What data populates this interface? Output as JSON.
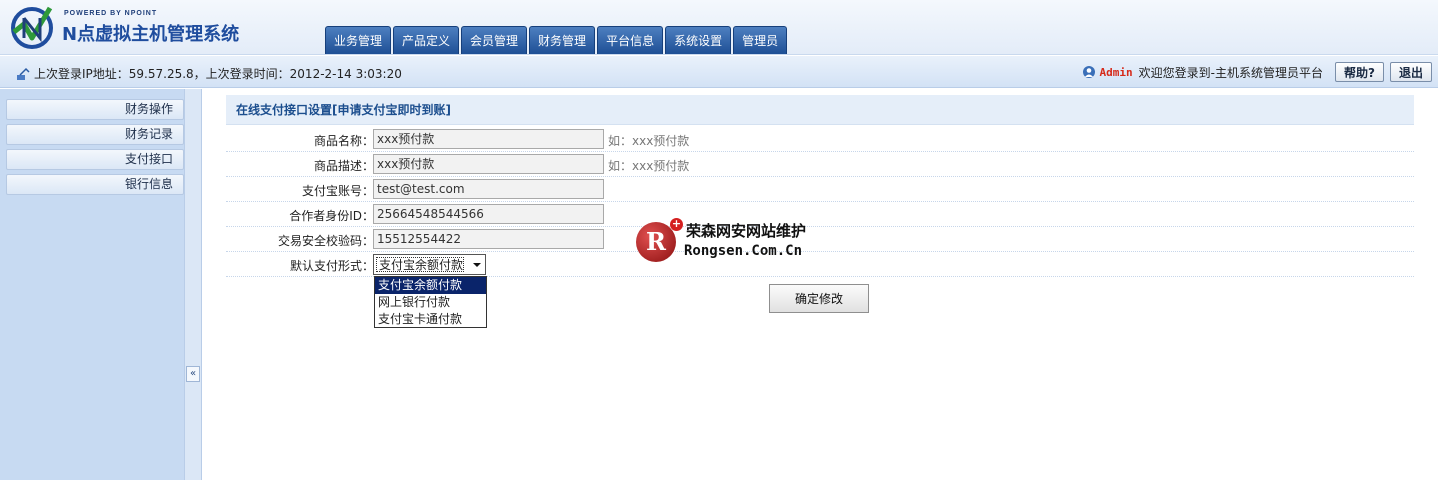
{
  "header": {
    "logo_powered": "POWERED BY NPOINT",
    "logo_title": "N点虚拟主机管理系统",
    "nav_tabs": [
      "业务管理",
      "产品定义",
      "会员管理",
      "财务管理",
      "平台信息",
      "系统设置",
      "管理员"
    ]
  },
  "infobar": {
    "login_info": "上次登录IP地址：59.57.25.8，上次登录时间：2012-2-14 3:03:20",
    "admin_name": "Admin",
    "welcome": "欢迎您登录到-主机系统管理员平台",
    "help_label": "帮助?",
    "logout_label": "退出"
  },
  "sidebar": {
    "items": [
      "财务操作",
      "财务记录",
      "支付接口",
      "银行信息"
    ],
    "collapse_label": "«"
  },
  "main": {
    "title": "在线支付接口设置[申请支付宝即时到账]",
    "fields": [
      {
        "label": "商品名称：",
        "value": "xxx预付款",
        "hint": "如：xxx预付款"
      },
      {
        "label": "商品描述：",
        "value": "xxx预付款",
        "hint": "如：xxx预付款"
      },
      {
        "label": "支付宝账号：",
        "value": "test@test.com",
        "hint": ""
      },
      {
        "label": "合作者身份ID：",
        "value": "25664548544566",
        "hint": ""
      },
      {
        "label": "交易安全校验码：",
        "value": "15512554422",
        "hint": ""
      }
    ],
    "payment_mode": {
      "label": "默认支付形式：",
      "selected": "支付宝余额付款",
      "options": [
        "支付宝余额付款",
        "网上银行付款",
        "支付宝卡通付款"
      ]
    },
    "submit_label": "确定修改"
  },
  "watermark": {
    "logo_letter": "R",
    "plus": "+",
    "text_cn": "荣森网安网站维护",
    "text_en": "Rongsen.Com.Cn"
  },
  "colors": {
    "nav_tab": "#2a5ba3",
    "sidebar_bg": "#c7daf2",
    "panel_title_text": "#1c4e8e",
    "admin_name": "#d62a1a",
    "dropdown_selected": "#0a246a"
  }
}
